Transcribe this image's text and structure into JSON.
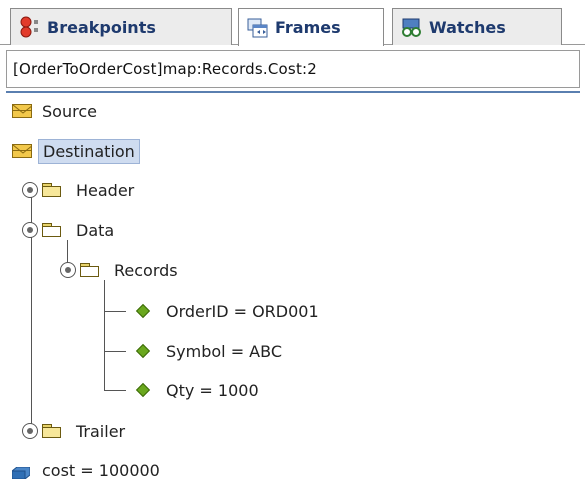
{
  "tabs": [
    {
      "label": "Breakpoints",
      "icon": "breakpoints-icon",
      "active": false
    },
    {
      "label": "Frames",
      "icon": "frames-icon",
      "active": true
    },
    {
      "label": "Watches",
      "icon": "watches-icon",
      "active": false
    }
  ],
  "path": "[OrderToOrderCost]map:Records.Cost:2",
  "tree": {
    "source": "Source",
    "destination": "Destination",
    "header": "Header",
    "data": "Data",
    "records": "Records",
    "order_id": "OrderID = ORD001",
    "symbol": "Symbol = ABC",
    "qty": "Qty = 1000",
    "trailer": "Trailer",
    "cost": "cost = 100000"
  },
  "colors": {
    "tab_text": "#1e3a6e",
    "selection": "#cfdcf0",
    "leaf_diamond": "#6aa81e"
  }
}
